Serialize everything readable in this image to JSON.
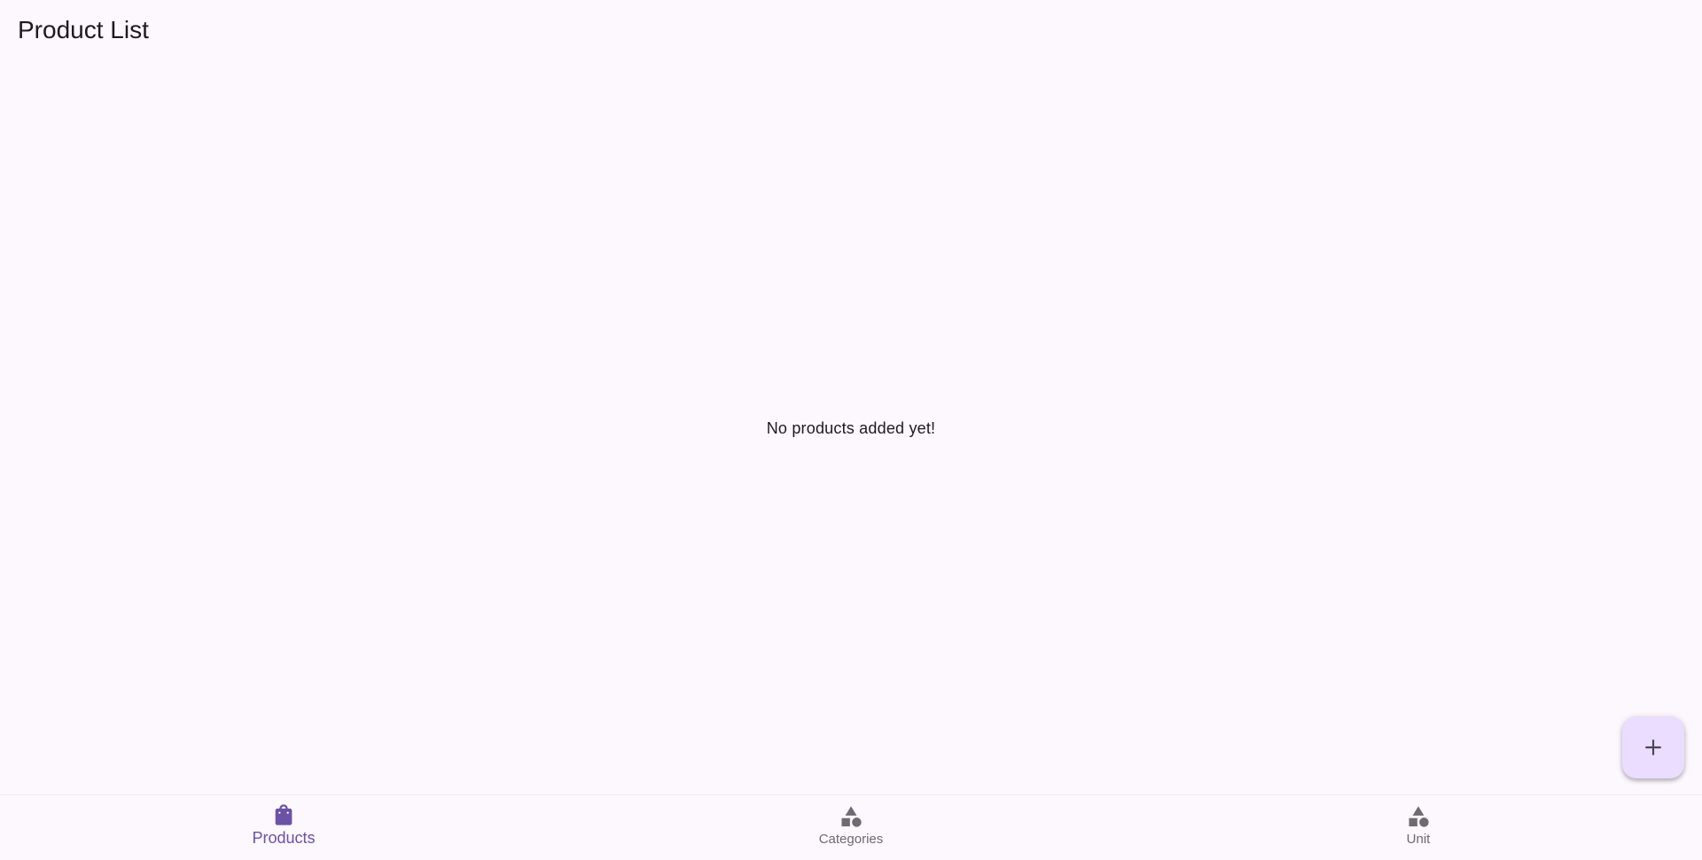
{
  "header": {
    "title": "Product List"
  },
  "main": {
    "empty_message": "No products added yet!"
  },
  "fab": {
    "icon": "add-icon",
    "color": "#eaddff"
  },
  "bottom_nav": {
    "active_color": "#6b52a6",
    "inactive_color": "#6e6a73",
    "items": [
      {
        "label": "Products",
        "icon": "shopping-bag-icon",
        "active": true
      },
      {
        "label": "Categories",
        "icon": "category-shapes-icon",
        "active": false
      },
      {
        "label": "Unit",
        "icon": "category-shapes-icon",
        "active": false
      }
    ]
  }
}
